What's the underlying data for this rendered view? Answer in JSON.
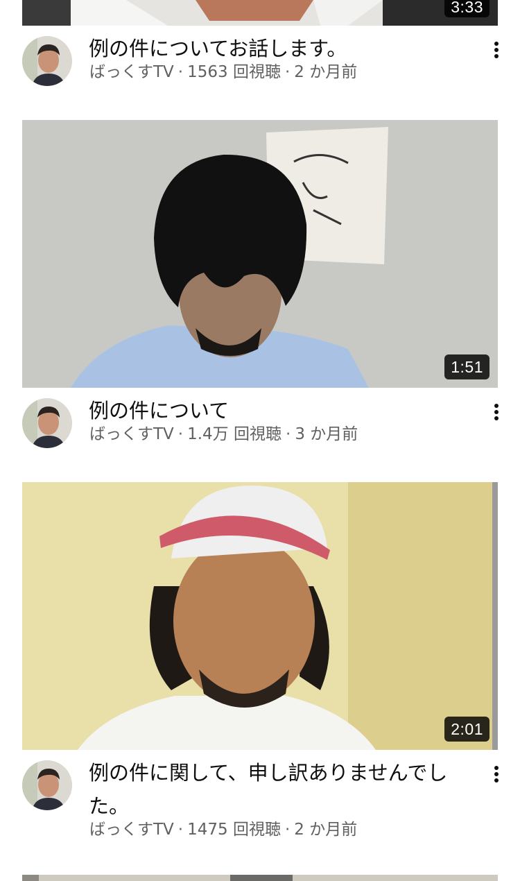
{
  "videos": [
    {
      "duration": "3:33",
      "title": "例の件についてお話します。",
      "channel": "ばっくすTV",
      "views": "1563 回視聴",
      "age": "2 か月前"
    },
    {
      "duration": "1:51",
      "title": "例の件について",
      "channel": "ばっくすTV",
      "views": "1.4万 回視聴",
      "age": "3 か月前"
    },
    {
      "duration": "2:01",
      "title": "例の件に関して、申し訳ありませんでした。",
      "channel": "ばっくすTV",
      "views": "1475 回視聴",
      "age": "2 か月前"
    }
  ],
  "icons": {
    "more": "more-vert-icon"
  },
  "colors": {
    "title_text": "#0f0f0f",
    "meta_text": "#606060",
    "duration_badge_bg": "#000000"
  }
}
